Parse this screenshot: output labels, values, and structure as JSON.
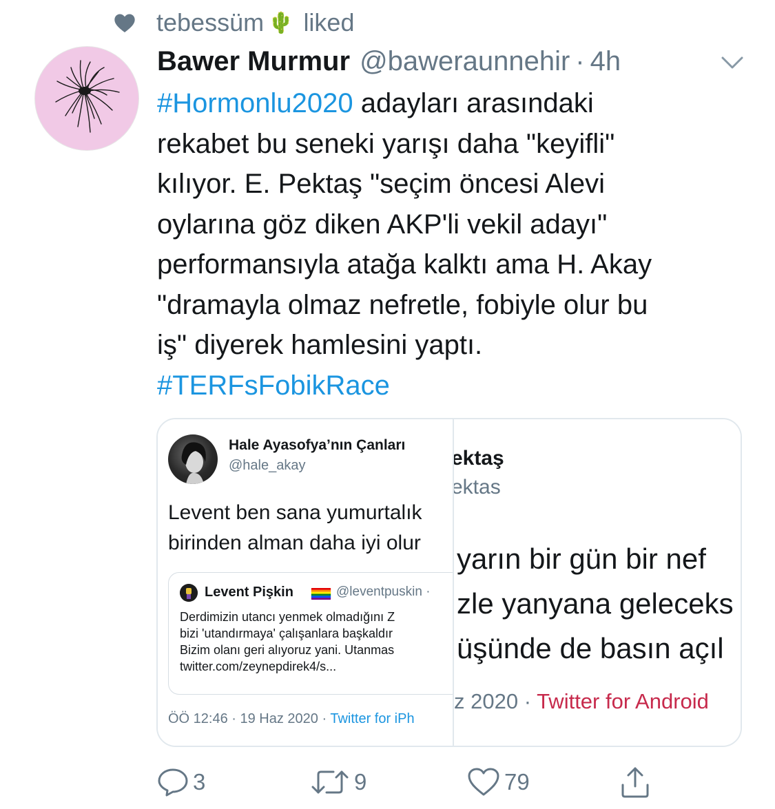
{
  "social_context": {
    "liker_name": "tebessüm",
    "liker_emoji": "🌵",
    "action_text": "liked"
  },
  "tweet": {
    "author_name": "Bawer Murmur",
    "author_handle": "@baweraunnehir",
    "separator": "·",
    "time": "4h",
    "text_lines": [
      {
        "hashtag": "#Hormonlu2020",
        "rest": " adayları arasındaki"
      },
      {
        "text": "rekabet bu seneki yarışı daha \"keyifli\""
      },
      {
        "text": "kılıyor. E. Pektaş \"seçim öncesi Alevi"
      },
      {
        "text": "oylarına göz diken AKP'li vekil adayı\""
      },
      {
        "text": "performansıyla atağa kalktı ama H. Akay"
      },
      {
        "text": "\"dramayla olmaz nefretle, fobiyle olur bu"
      },
      {
        "text": "iş\" diyerek hamlesini yaptı."
      },
      {
        "hashtag": "#TERFsFobikRace"
      }
    ]
  },
  "media": {
    "left": {
      "name": "Hale Ayasofya’nın Çanları",
      "handle": "@hale_akay",
      "text_lines": [
        "Levent ben sana yumurtalık",
        "birinden alman daha iyi olur"
      ],
      "quote": {
        "name": "Levent Pişkin",
        "handle": "@leventpuskin ·",
        "body_lines": [
          "Derdimizin utancı yenmek olmadığını Z",
          "bizi 'utandırmaya' çalışanlara başkaldır",
          "Bizim olanı geri alıyoruz yani. Utanmas",
          "twitter.com/zeynepdirek4/s..."
        ]
      },
      "meta_time": "ÖÖ 12:46 · 19 Haz 2020 · ",
      "meta_source": "Twitter for iPh"
    },
    "right": {
      "name": "ektaş",
      "handle": "ektas",
      "text_lines": [
        "yarın bir gün bir nef",
        "zle yanyana geleceks",
        "üşünde de basın açıl"
      ],
      "meta_date": "z 2020 · ",
      "meta_source": "Twitter for Android"
    }
  },
  "actions": {
    "reply_count": "3",
    "retweet_count": "9",
    "like_count": "79"
  },
  "colors": {
    "link": "#1b95e0",
    "secondary": "#657786",
    "avatar_bg": "#f1c9e6",
    "android_source": "#c72a4c"
  }
}
